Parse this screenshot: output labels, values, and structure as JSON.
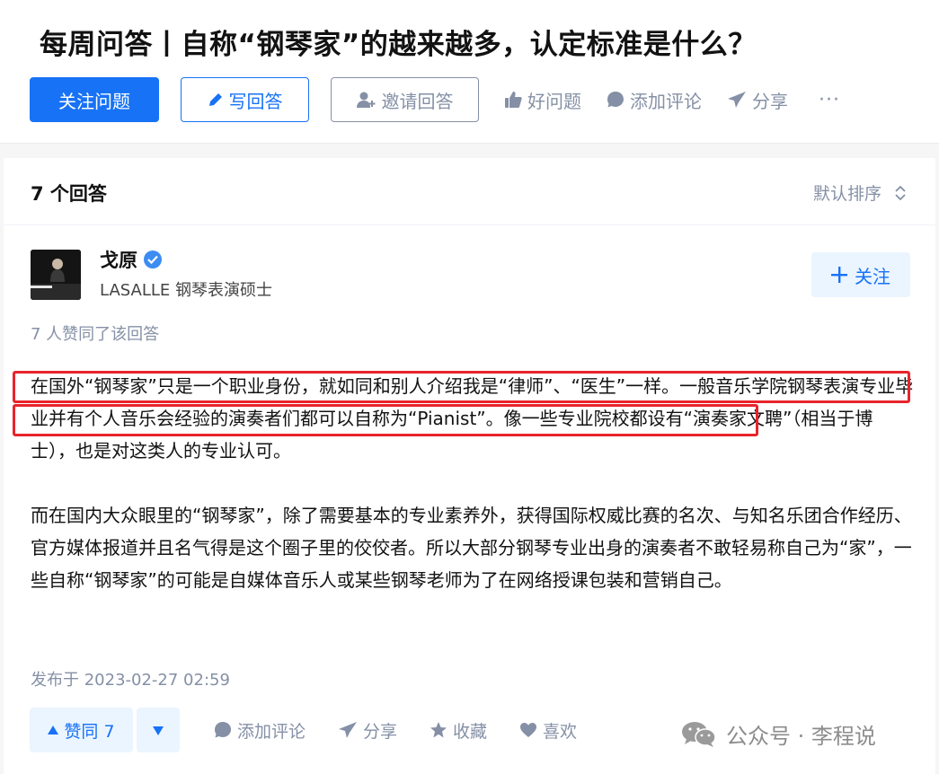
{
  "question": {
    "title": "每周问答丨自称“钢琴家”的越来越多，认定标准是什么？",
    "actions": {
      "follow": "关注问题",
      "write": "写回答",
      "invite": "邀请回答",
      "good": "好问题",
      "comment": "添加评论",
      "share": "分享",
      "more": "···"
    }
  },
  "answers_header": {
    "count": "7 个回答",
    "sort": "默认排序"
  },
  "answer": {
    "author": {
      "name": "戈原",
      "bio": "LASALLE 钢琴表演硕士",
      "follow": "关注"
    },
    "voters": "7 人赞同了该回答",
    "paragraphs": [
      "在国外“钢琴家”只是一个职业身份，就如同和别人介绍我是“律师”、“医生”一样。一般音乐学院钢琴表演专业毕业并有个人音乐会经验的演奏者们都可以自称为“Pianist”。像一些专业院校都设有“演奏家文聘”（相当于博士），也是对这类人的专业认可。",
      "而在国内大众眼里的“钢琴家”，除了需要基本的专业素养外，获得国际权威比赛的名次、与知名乐团合作经历、官方媒体报道并且名气得是这个圈子里的佼佼者。所以大部分钢琴专业出身的演奏者不敢轻易称自己为“家”，一些自称“钢琴家”的可能是自媒体音乐人或某些钢琴老师为了在网络授课包装和营销自己。"
    ],
    "published": "发布于 2023-02-27 02:59",
    "footer": {
      "upvote": "赞同 7",
      "comment": "添加评论",
      "share": "分享",
      "collect": "收藏",
      "like": "喜欢"
    }
  },
  "watermark": "公众号 · 李程说",
  "colors": {
    "brand_blue": "#1772f6",
    "muted": "#8590a6",
    "highlight_red": "#e8242b"
  }
}
